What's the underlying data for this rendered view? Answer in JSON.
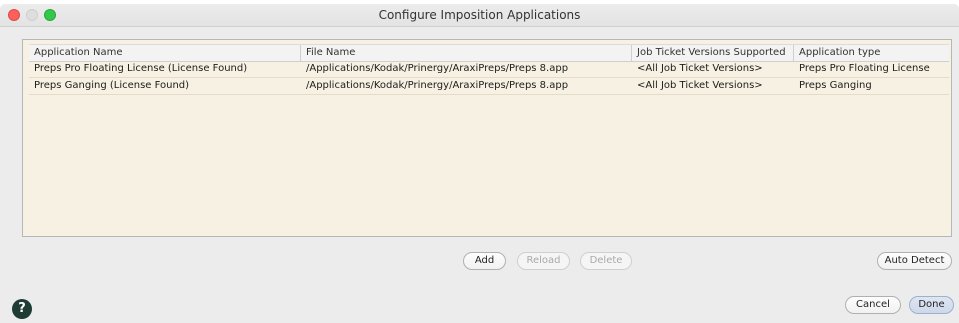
{
  "window": {
    "title": "Configure Imposition Applications"
  },
  "table": {
    "columns": [
      "Application Name",
      "File Name",
      "Job Ticket Versions Supported",
      "Application type"
    ],
    "rows": [
      [
        "Preps Pro Floating License (License Found)",
        "/Applications/Kodak/Prinergy/AraxiPreps/Preps 8.app",
        "<All Job Ticket Versions>",
        "Preps Pro Floating License"
      ],
      [
        "Preps Ganging (License Found)",
        "/Applications/Kodak/Prinergy/AraxiPreps/Preps 8.app",
        "<All Job Ticket Versions>",
        "Preps Ganging"
      ]
    ]
  },
  "buttons": {
    "add": "Add",
    "reload": "Reload",
    "delete": "Delete",
    "auto_detect": "Auto Detect",
    "cancel": "Cancel",
    "done": "Done",
    "help": "?"
  },
  "colors": {
    "close": "#fc605c",
    "maximize": "#34c84a",
    "table_background": "#f6f1e2",
    "help_button": "#1f3b35"
  }
}
